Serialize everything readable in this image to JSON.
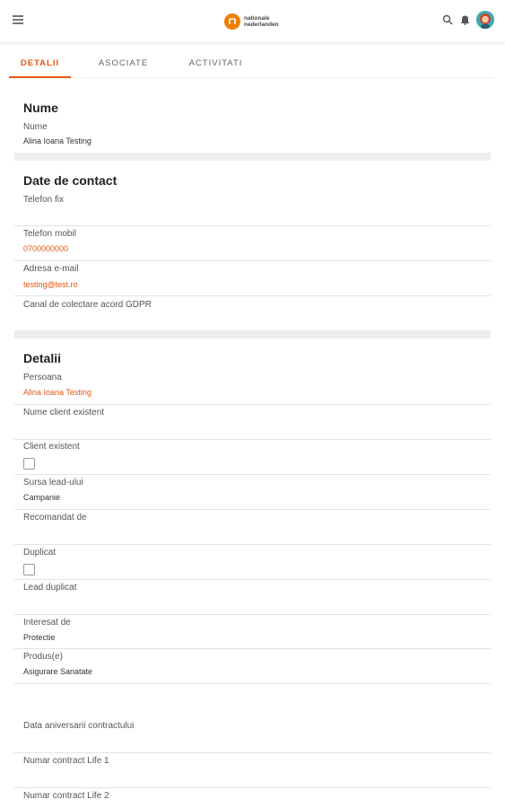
{
  "tabs": [
    {
      "label": "DETALII"
    },
    {
      "label": "ASOCIATE"
    },
    {
      "label": "ACTIVITATI"
    }
  ],
  "brand": {
    "line1": "nationale",
    "line2": "nederlanden",
    "accent": "#ee7f00"
  },
  "sections": {
    "nume": {
      "title": "Nume",
      "fields": [
        {
          "label": "Nume",
          "value": "Alina Ioana Testing"
        }
      ]
    },
    "contact": {
      "title": "Date de contact",
      "fields": [
        {
          "label": "Telefon fix",
          "value": ""
        },
        {
          "label": "Telefon mobil",
          "value": "0700000000"
        },
        {
          "label": "Adresa e-mail",
          "value": "testing@test.ro"
        },
        {
          "label": "Canal de colectare acord GDPR",
          "value": ""
        }
      ]
    },
    "detalii": {
      "title": "Detalii",
      "fields": [
        {
          "label": "Persoana",
          "value": "Alina Ioana Testing"
        },
        {
          "label": "Nume client existent",
          "value": ""
        },
        {
          "label": "Client existent",
          "checked": false
        },
        {
          "label": "Sursa lead-ului",
          "value": "Campanie"
        },
        {
          "label": "Recomandat de",
          "value": ""
        },
        {
          "label": "Duplicat",
          "checked": false
        },
        {
          "label": "Lead duplicat",
          "value": ""
        },
        {
          "label": "Interesat de",
          "value": "Protectie"
        },
        {
          "label": "Produs(e)",
          "value": "Asigurare Sanatate"
        },
        {
          "label": "Data aniversarii contractului",
          "value": ""
        },
        {
          "label": "Numar contract Life 1",
          "value": ""
        },
        {
          "label": "Numar contract Life 2",
          "value": ""
        }
      ]
    }
  },
  "colors": {
    "accent": "#e9560f"
  }
}
